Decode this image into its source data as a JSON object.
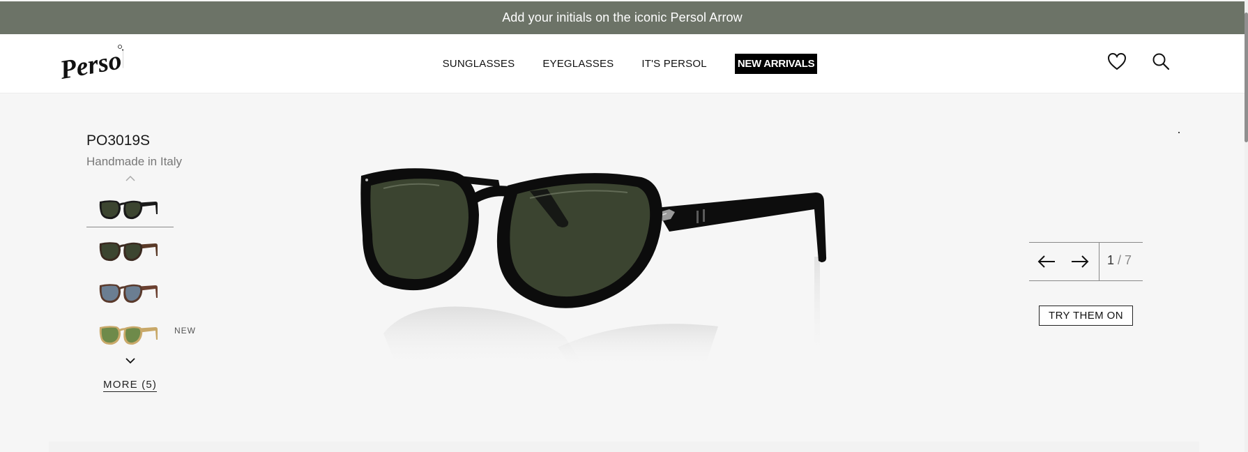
{
  "promo": {
    "text": "Add your initials on the iconic Persol Arrow"
  },
  "header": {
    "logo_text": "Persol",
    "nav": [
      {
        "label": "SUNGLASSES"
      },
      {
        "label": "EYEGLASSES"
      },
      {
        "label": "IT'S PERSOL"
      },
      {
        "label": "NEW ARRIVALS"
      }
    ],
    "icons": [
      "heart-icon",
      "search-icon"
    ]
  },
  "product": {
    "model": "PO3019S",
    "subtitle": "Handmade in Italy"
  },
  "variants": {
    "items": [
      {
        "frame": "#1a1a1a",
        "lens": "#3c4530",
        "temple": "#1a1a1a",
        "badge": ""
      },
      {
        "frame": "#3a2a20",
        "lens": "#3c4530",
        "temple": "#5a3a28",
        "badge": ""
      },
      {
        "frame": "#5a3a2c",
        "lens": "#6b7e92",
        "temple": "#6b4030",
        "badge": ""
      },
      {
        "frame": "#c9a96a",
        "lens": "#6e8a4a",
        "temple": "#c8a868",
        "badge": "NEW"
      }
    ],
    "more_label": "MORE (5)"
  },
  "gallery": {
    "current": "1",
    "separator": " / ",
    "total": "7",
    "try_on_label": "TRY THEM ON"
  },
  "colors": {
    "promo_bg": "#6c7367",
    "page_bg": "#f6f6f6",
    "lens_green": "#3b4430",
    "frame_black": "#0e0e0e"
  }
}
